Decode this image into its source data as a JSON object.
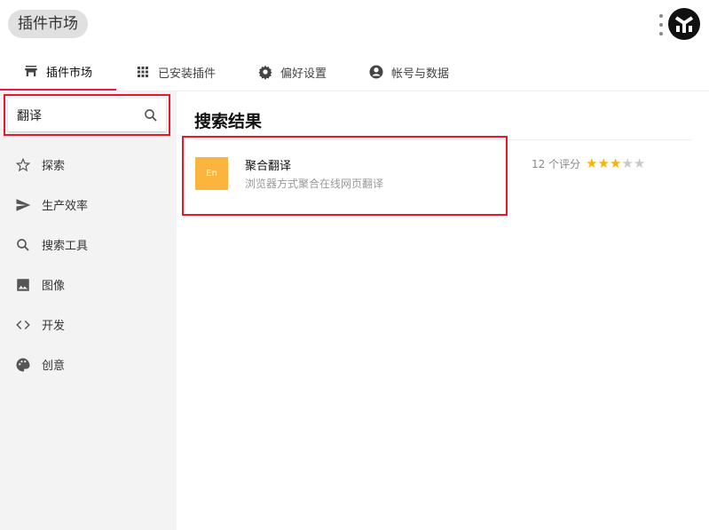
{
  "header": {
    "title": "插件市场"
  },
  "tabs": [
    {
      "label": "插件市场",
      "icon": "store-icon"
    },
    {
      "label": "已安装插件",
      "icon": "grid-icon"
    },
    {
      "label": "偏好设置",
      "icon": "gear-icon"
    },
    {
      "label": "帐号与数据",
      "icon": "account-icon"
    }
  ],
  "search": {
    "value": "翻译"
  },
  "sidebar": {
    "items": [
      {
        "label": "探索"
      },
      {
        "label": "生产效率"
      },
      {
        "label": "搜索工具"
      },
      {
        "label": "图像"
      },
      {
        "label": "开发"
      },
      {
        "label": "创意"
      }
    ]
  },
  "main": {
    "heading": "搜索结果",
    "results": [
      {
        "name": "聚合翻译",
        "description": "浏览器方式聚合在线网页翻译",
        "rating_count": "12 个评分",
        "stars": 3,
        "max_stars": 5,
        "icon_text": "En"
      }
    ]
  },
  "colors": {
    "accent": "#e5194d",
    "star": "#f5b400",
    "star_empty": "#c8c8c8",
    "plugin_icon": "#fbb53f"
  }
}
